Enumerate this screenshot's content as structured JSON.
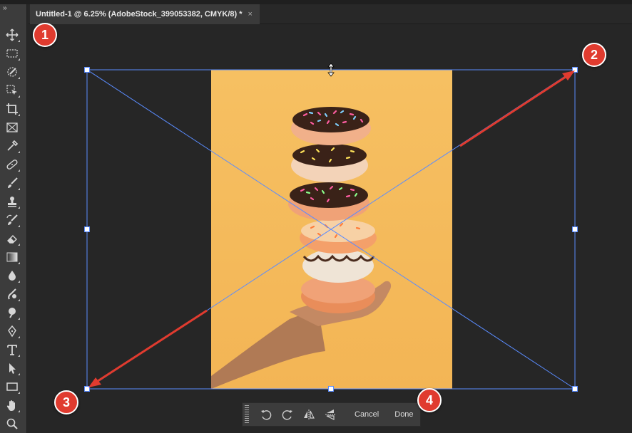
{
  "toolbar": {
    "collapse_label": "››",
    "tools": [
      {
        "name": "move-tool",
        "icon": "move-icon"
      },
      {
        "name": "marquee-tool",
        "icon": "rect-marquee-icon"
      },
      {
        "name": "quick-selection-tool",
        "icon": "quick-selection-icon"
      },
      {
        "name": "object-selection-tool",
        "icon": "object-selection-icon"
      },
      {
        "name": "crop-tool",
        "icon": "crop-icon"
      },
      {
        "name": "frame-tool",
        "icon": "frame-icon"
      },
      {
        "name": "eyedropper-tool",
        "icon": "eyedropper-icon"
      },
      {
        "name": "healing-brush-tool",
        "icon": "bandage-icon"
      },
      {
        "name": "brush-tool",
        "icon": "brush-icon"
      },
      {
        "name": "clone-stamp-tool",
        "icon": "stamp-icon"
      },
      {
        "name": "history-brush-tool",
        "icon": "history-brush-icon"
      },
      {
        "name": "eraser-tool",
        "icon": "eraser-icon"
      },
      {
        "name": "gradient-tool",
        "icon": "gradient-icon"
      },
      {
        "name": "blur-tool",
        "icon": "drop-icon"
      },
      {
        "name": "smudge-tool",
        "icon": "smudge-icon"
      },
      {
        "name": "dodge-tool",
        "icon": "dodge-icon"
      },
      {
        "name": "pen-tool",
        "icon": "pen-icon"
      },
      {
        "name": "type-tool",
        "icon": "type-icon"
      },
      {
        "name": "path-selection-tool",
        "icon": "arrow-icon"
      },
      {
        "name": "rectangle-tool",
        "icon": "rectangle-icon"
      },
      {
        "name": "hand-tool",
        "icon": "hand-icon"
      },
      {
        "name": "zoom-tool",
        "icon": "magnifier-icon"
      }
    ]
  },
  "document_tab": {
    "title": "Untitled-1 @ 6.25% (AdobeStock_399053382, CMYK/8) *",
    "close_glyph": "×"
  },
  "transform_bar": {
    "icons": [
      "rotate-ccw-icon",
      "rotate-cw-icon",
      "flip-horizontal-icon",
      "flip-vertical-icon"
    ],
    "cancel_label": "Cancel",
    "done_label": "Done"
  },
  "annotations": {
    "marker_1": "1",
    "marker_2": "2",
    "marker_3": "3",
    "marker_4": "4"
  },
  "colors": {
    "annotation_red": "#e03b2f",
    "transform_box_blue": "#5a8cff",
    "photo_background": "#f5bb5c"
  }
}
